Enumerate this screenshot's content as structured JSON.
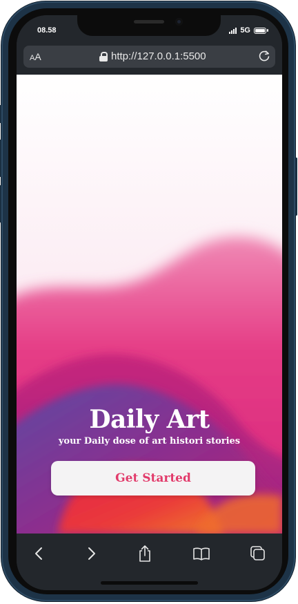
{
  "status_bar": {
    "time": "08.58",
    "network": "5G"
  },
  "address_bar": {
    "text_size_label_small": "A",
    "text_size_label_large": "A",
    "url": "http://127.0.0.1:5500"
  },
  "hero": {
    "title": "Daily Art",
    "subtitle": "your Daily dose of art histori stories",
    "cta_label": "Get Started"
  },
  "toolbar": {
    "icons": [
      "back-icon",
      "forward-icon",
      "share-icon",
      "bookmarks-icon",
      "tabs-icon"
    ]
  },
  "colors": {
    "accent": "#e23b6b",
    "frame": "#1d3347",
    "chrome": "#23272c",
    "address_bar": "#3a3e44",
    "gradient_pink": "#e0307f",
    "gradient_purple": "#5a3b9e",
    "gradient_orange": "#ef6a2e"
  }
}
